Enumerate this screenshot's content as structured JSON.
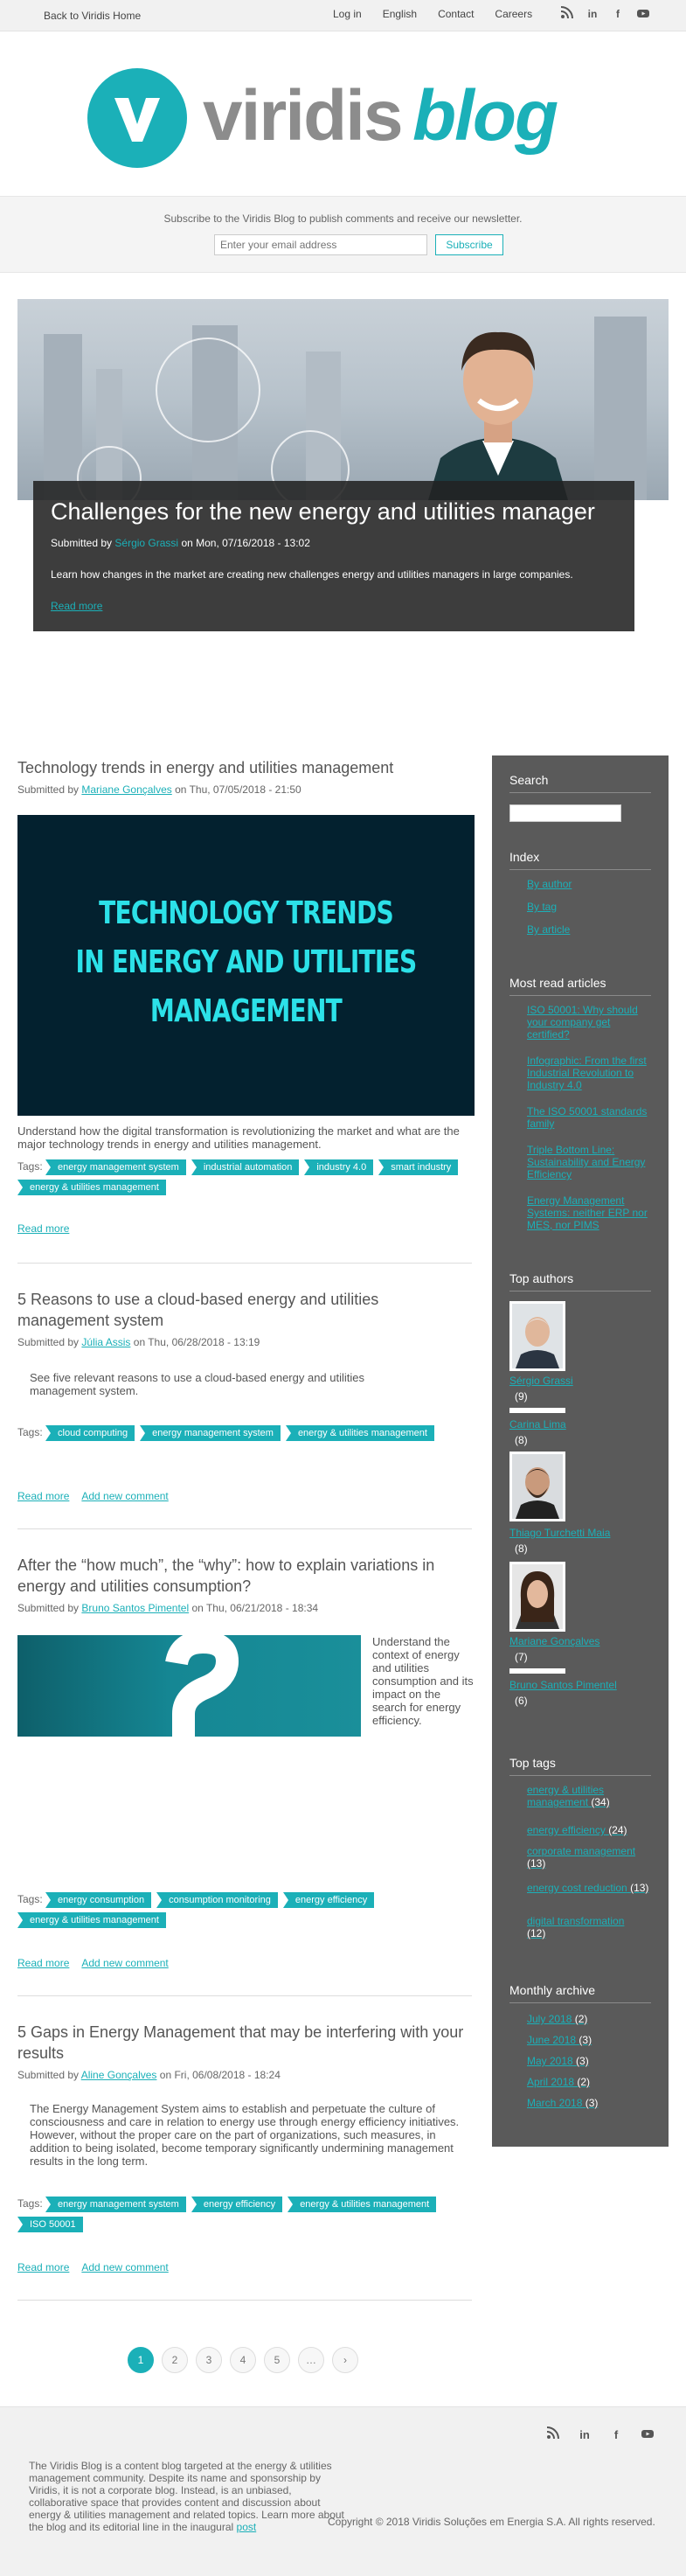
{
  "topbar": {
    "home": "Back to Viridis Home",
    "nav": [
      "Log in",
      "English",
      "Contact",
      "Careers"
    ],
    "social": [
      "rss-icon",
      "linkedin-icon",
      "facebook-icon",
      "youtube-icon"
    ]
  },
  "logo": {
    "part1": "viridis",
    "part2": "blog",
    "initial": "v"
  },
  "subscribe": {
    "text": "Subscribe to the Viridis Blog to publish comments and receive our newsletter.",
    "placeholder": "Enter your email address",
    "button": "Subscribe"
  },
  "hero": {
    "title": "Challenges for the new energy and utilities manager",
    "submitted": "Submitted by",
    "author": "Sérgio Grassi",
    "date": "on Mon, 07/16/2018 - 13:02",
    "description": "Learn how changes in the market are creating new challenges energy and utilities managers in large companies.",
    "more": "Read more"
  },
  "posts": [
    {
      "title": "Technology trends in energy and utilities management",
      "submitted": "Submitted by",
      "author": "Mariane Gonçalves",
      "date": "on Thu, 07/05/2018 - 21:50",
      "image_lines": [
        "TECHNOLOGY TRENDS",
        "IN ENERGY AND UTILITIES",
        "MANAGEMENT"
      ],
      "excerpt": "Understand how the digital transformation is revolutionizing the market and what are the major technology trends in energy and utilities management.",
      "tags_label": "Tags:",
      "tags": [
        "energy management system",
        "industrial automation",
        "industry 4.0",
        "smart industry",
        "energy & utilities management"
      ],
      "links": [
        "Read more"
      ]
    },
    {
      "title": "5 Reasons to use a cloud-based energy and utilities management system",
      "submitted": "Submitted by",
      "author": "Júlia Assis",
      "date": "on Thu, 06/28/2018 - 13:19",
      "excerpt": "See five relevant reasons to use a cloud-based energy and utilities management system.",
      "tags_label": "Tags:",
      "tags": [
        "cloud computing",
        "energy management system",
        "energy & utilities management"
      ],
      "links": [
        "Read more",
        "Add new comment"
      ]
    },
    {
      "title": "After the “how much”, the “why”: how to explain variations in energy and utilities consumption?",
      "submitted": "Submitted by",
      "author": "Bruno Santos Pimentel",
      "date": "on Thu, 06/21/2018 - 18:34",
      "excerpt": "Understand the context of energy and utilities consumption and its impact on the search for energy efficiency.",
      "tags_label": "Tags:",
      "tags": [
        "energy consumption",
        "consumption monitoring",
        "energy efficiency",
        "energy & utilities management"
      ],
      "links": [
        "Read more",
        "Add new comment"
      ]
    },
    {
      "title": "5 Gaps in Energy Management that may be interfering with your results",
      "submitted": "Submitted by",
      "author": "Aline Gonçalves",
      "date": "on Fri, 06/08/2018 - 18:24",
      "excerpt": "The Energy Management System aims to establish and perpetuate the culture of consciousness and care in relation to energy use through energy efficiency initiatives. However, without the proper care on the part of organizations, such measures, in addition to being isolated, become temporary significantly undermining management results in the long term.",
      "tags_label": "Tags:",
      "tags": [
        "energy management system",
        "energy efficiency",
        "energy & utilities management",
        "ISO 50001"
      ],
      "links": [
        "Read more",
        "Add new comment"
      ]
    }
  ],
  "sidebar": {
    "search_title": "Search",
    "index_title": "Index",
    "index": [
      "By author",
      "By tag",
      "By article"
    ],
    "most_read_title": "Most read articles",
    "most_read": [
      "ISO 50001: Why should your company get certified?",
      "Infographic: From the first Industrial Revolution to Industry 4.0",
      "The ISO 50001 standards family",
      "Triple Bottom Line: Sustainability and Energy Efficiency",
      "Energy Management Systems: neither ERP nor MES, nor PIMS"
    ],
    "top_authors_title": "Top authors",
    "authors": [
      {
        "name": "Sérgio Grassi",
        "count": "(9)"
      },
      {
        "name": "Carina Lima",
        "count": "(8)"
      },
      {
        "name": "Thiago Turchetti Maia",
        "count": "(8)"
      },
      {
        "name": "Mariane Gonçalves",
        "count": "(7)"
      },
      {
        "name": "Bruno Santos Pimentel",
        "count": "(6)"
      }
    ],
    "top_tags_title": "Top tags",
    "tags": [
      {
        "name": "energy & utilities management",
        "count": "(34)"
      },
      {
        "name": "energy efficiency",
        "count": "(24)"
      },
      {
        "name": "corporate management",
        "count": "(13)"
      },
      {
        "name": "energy cost reduction",
        "count": "(13)"
      },
      {
        "name": "digital transformation",
        "count": "(12)"
      }
    ],
    "archive_title": "Monthly archive",
    "archive": [
      {
        "name": "July 2018",
        "count": "(2)"
      },
      {
        "name": "June 2018",
        "count": "(3)"
      },
      {
        "name": "May 2018",
        "count": "(3)"
      },
      {
        "name": "April 2018",
        "count": "(2)"
      },
      {
        "name": "March 2018",
        "count": "(3)"
      }
    ]
  },
  "pager": [
    "1",
    "2",
    "3",
    "4",
    "5",
    "…",
    "›"
  ],
  "footer": {
    "about": "The Viridis Blog is a content blog targeted at the energy & utilities management community. Despite its name and sponsorship by Viridis, it is not a corporate blog. Instead, is an unbiased, collaborative space that provides content and discussion about energy & utilities management and related topics. Learn more about the blog and its editorial line in the inaugural",
    "about_link": "post",
    "copyright": "Copyright © 2018 Viridis Soluções em Energia S.A. All rights reserved."
  },
  "colors": {
    "accent": "#1bb0b8",
    "sidebar": "#5a5a5a",
    "dark_card": "#222222"
  }
}
